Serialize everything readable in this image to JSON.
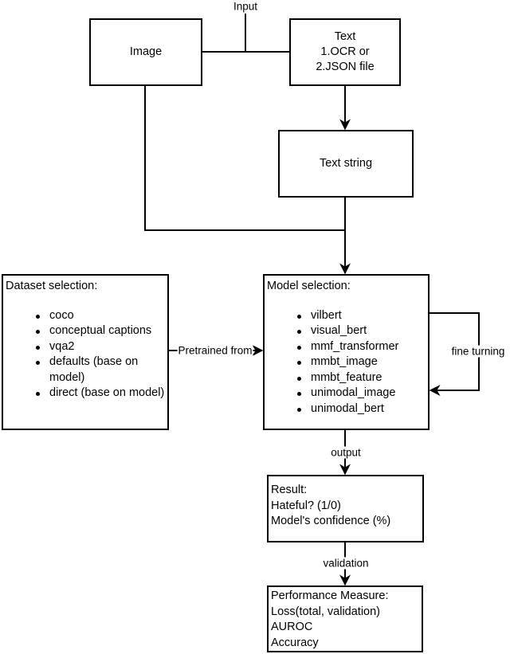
{
  "input_label": "Input",
  "image_box": {
    "label": "Image"
  },
  "text_box": {
    "lines": [
      "Text",
      "1.OCR or",
      "2.JSON file"
    ]
  },
  "text_string_box": {
    "label": "Text string"
  },
  "dataset_box": {
    "title": "Dataset selection:",
    "items": [
      "coco",
      "conceptual captions",
      "vqa2",
      "defaults (base on model)",
      "direct (base on model)"
    ]
  },
  "pretrained_label": "Pretrained from",
  "model_box": {
    "title": "Model selection:",
    "items": [
      "vilbert",
      "visual_bert",
      "mmf_transformer",
      "mmbt_image",
      "mmbt_feature",
      "unimodal_image",
      "unimodal_bert"
    ]
  },
  "fine_tuning_label": "fine turning",
  "output_label": "output",
  "result_box": {
    "lines": [
      "Result:",
      "Hateful? (1/0)",
      "Model's confidence (%)"
    ]
  },
  "validation_label": "validation",
  "performance_box": {
    "lines": [
      "Performance Measure:",
      "Loss(total, validation)",
      "AUROC",
      "Accuracy"
    ]
  }
}
